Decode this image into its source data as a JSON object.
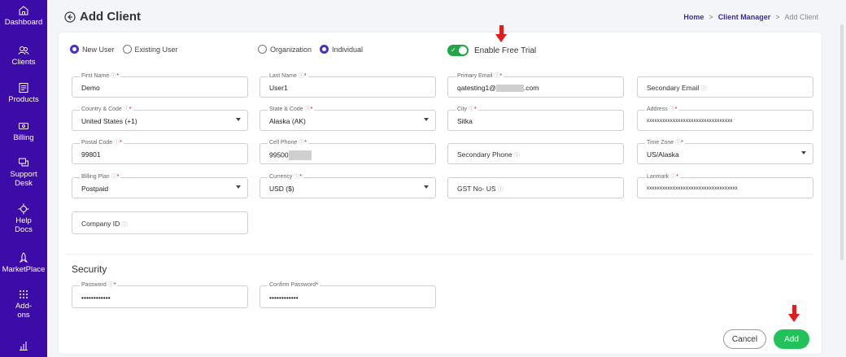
{
  "sidebar": {
    "items": [
      {
        "label": "Dashboard",
        "icon": "home-icon"
      },
      {
        "label": "Clients",
        "icon": "users-icon"
      },
      {
        "label": "Products",
        "icon": "products-icon"
      },
      {
        "label": "Billing",
        "icon": "billing-icon"
      },
      {
        "label": "Support Desk",
        "icon": "support-icon"
      },
      {
        "label": "Help Docs",
        "icon": "help-icon"
      },
      {
        "label": "MarketPlace",
        "icon": "rocket-icon"
      },
      {
        "label": "Add-ons",
        "icon": "grid-icon"
      },
      {
        "label": "",
        "icon": "chart-icon"
      }
    ]
  },
  "header": {
    "title": "Add Client",
    "breadcrumb": {
      "home": "Home",
      "sep": ">",
      "parent": "Client Manager",
      "current": "Add Client"
    }
  },
  "user_type": {
    "new": "New User",
    "existing": "Existing User",
    "selected": "New User"
  },
  "client_type": {
    "org": "Organization",
    "individual": "Individual",
    "selected": "Individual"
  },
  "free_trial": {
    "label": "Enable Free Trial",
    "enabled": true
  },
  "form": {
    "first_name": {
      "label": "First Name",
      "value": "Demo"
    },
    "last_name": {
      "label": "Last Name",
      "value": "User1"
    },
    "primary_email": {
      "label": "Primary Email",
      "value_prefix": "qatesting1@",
      "value_suffix": ".com"
    },
    "secondary_email": {
      "placeholder": "Secondary Email"
    },
    "country": {
      "label": "Country & Code",
      "value": "United States (+1)"
    },
    "state": {
      "label": "State & Code",
      "value": "Alaska (AK)"
    },
    "city": {
      "label": "City",
      "value": "Sitka"
    },
    "address": {
      "label": "Address",
      "value": "xxxxxxxxxxxxxxxxxxxxxxxxxxxxxxxxx"
    },
    "postal_code": {
      "label": "Postal Code",
      "value": "99801"
    },
    "cell_phone": {
      "label": "Cell Phone",
      "value": "99500"
    },
    "secondary_phone": {
      "placeholder": "Secondary Phone"
    },
    "time_zone": {
      "label": "Time Zone",
      "value": "US/Alaska"
    },
    "billing_plan": {
      "label": "Billing Plan",
      "value": "Postpaid"
    },
    "currency": {
      "label": "Currency",
      "value": "USD ($)"
    },
    "gst": {
      "placeholder": "GST No- US"
    },
    "landmark": {
      "label": "Lanmark",
      "value": "xxxxxxxxxxxxxxxxxxxxxxxxxxxxxxxxxxx"
    },
    "company_id": {
      "placeholder": "Company ID"
    }
  },
  "security": {
    "title": "Security",
    "password": {
      "label": "Password",
      "value": "••••••••••••"
    },
    "confirm_password": {
      "label": "Confirm Password",
      "value": "••••••••••••"
    }
  },
  "actions": {
    "cancel": "Cancel",
    "add": "Add"
  },
  "colors": {
    "sidebar": "#3d0ba8",
    "accent": "#4b2fd0",
    "success": "#22c25a",
    "annotation": "#e21b1b"
  }
}
